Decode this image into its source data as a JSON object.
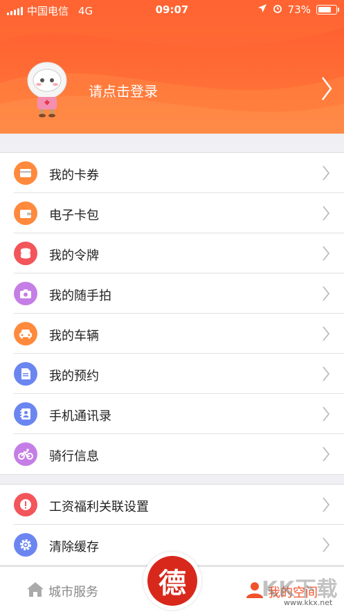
{
  "status_bar": {
    "carrier": "中国电信",
    "network": "4G",
    "time": "09:07",
    "battery": "73%",
    "battery_level": 0.73
  },
  "header": {
    "login_text": "请点击登录"
  },
  "menu_group1": [
    {
      "label": "我的卡券",
      "icon": "card-icon",
      "color": "#ff8a3d"
    },
    {
      "label": "电子卡包",
      "icon": "wallet-icon",
      "color": "#ff8a3d"
    },
    {
      "label": "我的令牌",
      "icon": "coin-stack-icon",
      "color": "#f2555a"
    },
    {
      "label": "我的随手拍",
      "icon": "camera-icon",
      "color": "#c57ee6"
    },
    {
      "label": "我的车辆",
      "icon": "car-icon",
      "color": "#ff8a3d"
    },
    {
      "label": "我的预约",
      "icon": "document-icon",
      "color": "#6b86f0"
    },
    {
      "label": "手机通讯录",
      "icon": "contacts-icon",
      "color": "#6b86f0"
    },
    {
      "label": "骑行信息",
      "icon": "bicycle-icon",
      "color": "#c57ee6"
    }
  ],
  "menu_group2": [
    {
      "label": "工资福利关联设置",
      "icon": "alert-icon",
      "color": "#f2555a"
    },
    {
      "label": "清除缓存",
      "icon": "gear-icon",
      "color": "#6b86f0"
    }
  ],
  "tabbar": {
    "home_label": "城市服务",
    "center_label": "德",
    "me_label": "我的空间",
    "accent": "#f0522c"
  },
  "watermark": {
    "text": "KK下载",
    "url": "www.kkx.net"
  }
}
